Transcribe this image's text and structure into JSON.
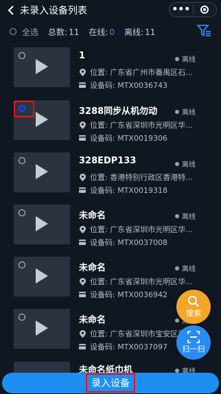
{
  "header": {
    "title": "未录入设备列表",
    "more": "•••"
  },
  "stats": {
    "select_all": "全选",
    "total_label": "总数:",
    "total": "11",
    "online_label": "在线:",
    "online": "0",
    "offline_label": "离线:",
    "offline": "11"
  },
  "devices": [
    {
      "name": "1",
      "status": "离线",
      "location": "位置: 广东省广州市番禺区石...",
      "code": "设备码: MTX0036743"
    },
    {
      "name": "3288同步从机勿动",
      "status": "离线",
      "location": "位置: 广东省深圳市光明区华...",
      "code": "设备码: MTX0019306"
    },
    {
      "name": "328EDP133",
      "status": "离线",
      "location": "位置: 香港特别行政区香港特...",
      "code": "设备码: MTX0019318"
    },
    {
      "name": "未命名",
      "status": "离线",
      "location": "位置: 广东省深圳市光明区华...",
      "code": "设备码: MTX0037008"
    },
    {
      "name": "未命名",
      "status": "离线",
      "location": "位置: 广东省深圳市光明区华...",
      "code": "设备码: MTX0036942"
    },
    {
      "name": "未命名",
      "status": "离线",
      "location": "位置: 广东省深圳市宝安区黄...",
      "code": "设备码: MTX0037097"
    },
    {
      "name": "未命名纸巾机",
      "status": "离线"
    }
  ],
  "fabs": {
    "search": "搜索",
    "scan": "扫一扫"
  },
  "bottom": {
    "label": "录入设备"
  },
  "colors": {
    "accent": "#1e8ff2",
    "fab_search": "#f4a52a",
    "selected": "#1b2fb8",
    "highlight": "#ee1111"
  }
}
